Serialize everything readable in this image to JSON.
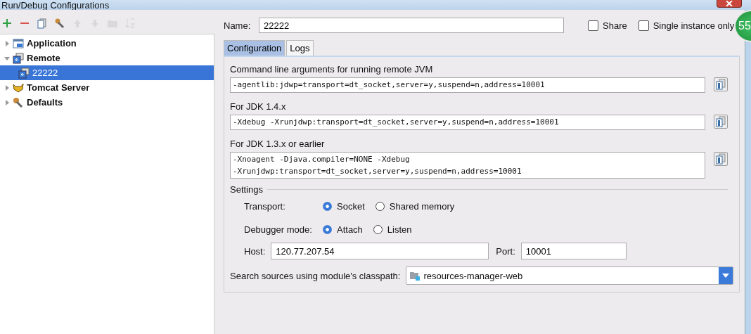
{
  "window": {
    "title": "Run/Debug Configurations"
  },
  "toolbar": [
    {
      "kind": "add",
      "disabled": false
    },
    {
      "kind": "remove",
      "disabled": false
    },
    {
      "kind": "copy",
      "disabled": false
    },
    {
      "kind": "wrench",
      "disabled": false
    },
    {
      "kind": "up",
      "disabled": true
    },
    {
      "kind": "down",
      "disabled": true
    },
    {
      "kind": "folder",
      "disabled": true
    },
    {
      "kind": "sort",
      "disabled": true
    }
  ],
  "tree": [
    {
      "label": "Application",
      "kind": "application",
      "expanded": false,
      "selected": false
    },
    {
      "label": "Remote",
      "kind": "remote",
      "expanded": true,
      "selected": false,
      "children": [
        {
          "label": "22222",
          "kind": "remote",
          "selected": true
        }
      ]
    },
    {
      "label": "Tomcat Server",
      "kind": "tomcat",
      "expanded": false,
      "selected": false
    },
    {
      "label": "Defaults",
      "kind": "wrench",
      "expanded": false,
      "selected": false
    }
  ],
  "name": {
    "label": "Name:",
    "value": "22222"
  },
  "options": [
    {
      "label": "Share",
      "checked": false
    },
    {
      "label": "Single instance only",
      "checked": false
    }
  ],
  "tabs": [
    {
      "label": "Configuration",
      "selected": true
    },
    {
      "label": "Logs",
      "selected": false
    }
  ],
  "arguments": [
    {
      "label": "Command line arguments for running remote JVM",
      "lines": [
        "-agentlib:jdwp=transport=dt_socket,server=y,suspend=n,address=10001"
      ]
    },
    {
      "label": "For JDK 1.4.x",
      "lines": [
        "-Xdebug -Xrunjdwp:transport=dt_socket,server=y,suspend=n,address=10001"
      ]
    },
    {
      "label": "For JDK 1.3.x or earlier",
      "lines": [
        "-Xnoagent -Djava.compiler=NONE -Xdebug",
        "-Xrunjdwp:transport=dt_socket,server=y,suspend=n,address=10001"
      ]
    }
  ],
  "settings": {
    "title": "Settings",
    "radio_groups": [
      {
        "label": "Transport:",
        "options": [
          {
            "label": "Socket",
            "selected": true
          },
          {
            "label": "Shared memory",
            "selected": false
          }
        ]
      },
      {
        "label": "Debugger mode:",
        "options": [
          {
            "label": "Attach",
            "selected": true
          },
          {
            "label": "Listen",
            "selected": false
          }
        ]
      }
    ],
    "host": {
      "label": "Host:",
      "value": "120.77.207.54"
    },
    "port": {
      "label": "Port:",
      "value": "10001"
    },
    "module": {
      "label": "Search sources using module's classpath:",
      "value": "resources-manager-web"
    }
  },
  "badge": {
    "text": "55"
  }
}
